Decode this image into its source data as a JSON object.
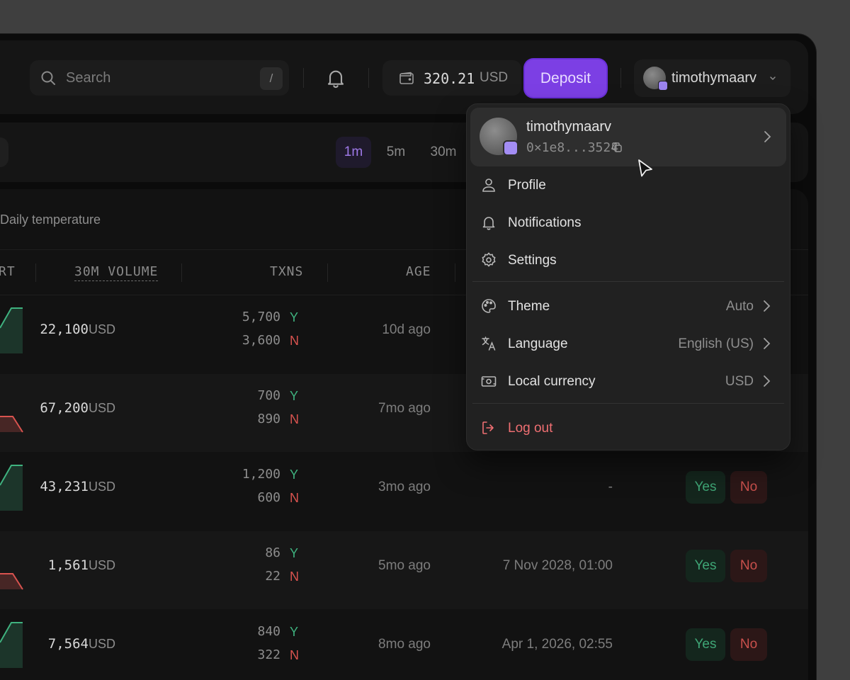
{
  "header": {
    "search_placeholder": "Search",
    "search_shortcut": "/",
    "wallet_amount": "320.21",
    "wallet_currency": "USD",
    "deposit_label": "Deposit",
    "username": "timothymaarv"
  },
  "timeframes": [
    {
      "label": "1m",
      "active": true
    },
    {
      "label": "5m",
      "active": false
    },
    {
      "label": "30m",
      "active": false
    }
  ],
  "panel": {
    "title": "Daily temperature",
    "columns": {
      "chart_fragment": "RT",
      "volume": "30M VOLUME",
      "txns": "TXNS",
      "age": "AGE"
    }
  },
  "rows": [
    {
      "trend": "up",
      "volume": "22,100",
      "volume_unit": "USD",
      "yes_txns": "5,700",
      "no_txns": "3,600",
      "age": "10d ago",
      "end": "",
      "yes": "",
      "no": ""
    },
    {
      "trend": "down",
      "volume": "67,200",
      "volume_unit": "USD",
      "yes_txns": "700",
      "no_txns": "890",
      "age": "7mo ago",
      "end": "",
      "yes": "",
      "no": ""
    },
    {
      "trend": "up",
      "volume": "43,231",
      "volume_unit": "USD",
      "yes_txns": "1,200",
      "no_txns": "600",
      "age": "3mo ago",
      "end": "-",
      "yes": "Yes",
      "no": "No"
    },
    {
      "trend": "down",
      "volume": "1,561",
      "volume_unit": "USD",
      "yes_txns": "86",
      "no_txns": "22",
      "age": "5mo ago",
      "end": "7 Nov 2028, 01:00",
      "yes": "Yes",
      "no": "No"
    },
    {
      "trend": "up",
      "volume": "7,564",
      "volume_unit": "USD",
      "yes_txns": "840",
      "no_txns": "322",
      "age": "8mo ago",
      "end": "Apr 1, 2026, 02:55",
      "yes": "Yes",
      "no": "No"
    }
  ],
  "yn_labels": {
    "y": "Y",
    "n": "N"
  },
  "menu": {
    "username": "timothymaarv",
    "address": "0×1e8...3524",
    "items": [
      {
        "label": "Profile",
        "icon": "user-icon"
      },
      {
        "label": "Notifications",
        "icon": "bell-icon"
      },
      {
        "label": "Settings",
        "icon": "gear-icon"
      }
    ],
    "settings": [
      {
        "label": "Theme",
        "value": "Auto",
        "icon": "palette-icon"
      },
      {
        "label": "Language",
        "value": "English (US)",
        "icon": "translate-icon"
      },
      {
        "label": "Local currency",
        "value": "USD",
        "icon": "banknote-icon"
      }
    ],
    "logout": "Log out"
  },
  "colors": {
    "accent": "#7c3fe4",
    "positive": "#3fb27f",
    "negative": "#d9534f",
    "logout": "#ef6f72"
  }
}
